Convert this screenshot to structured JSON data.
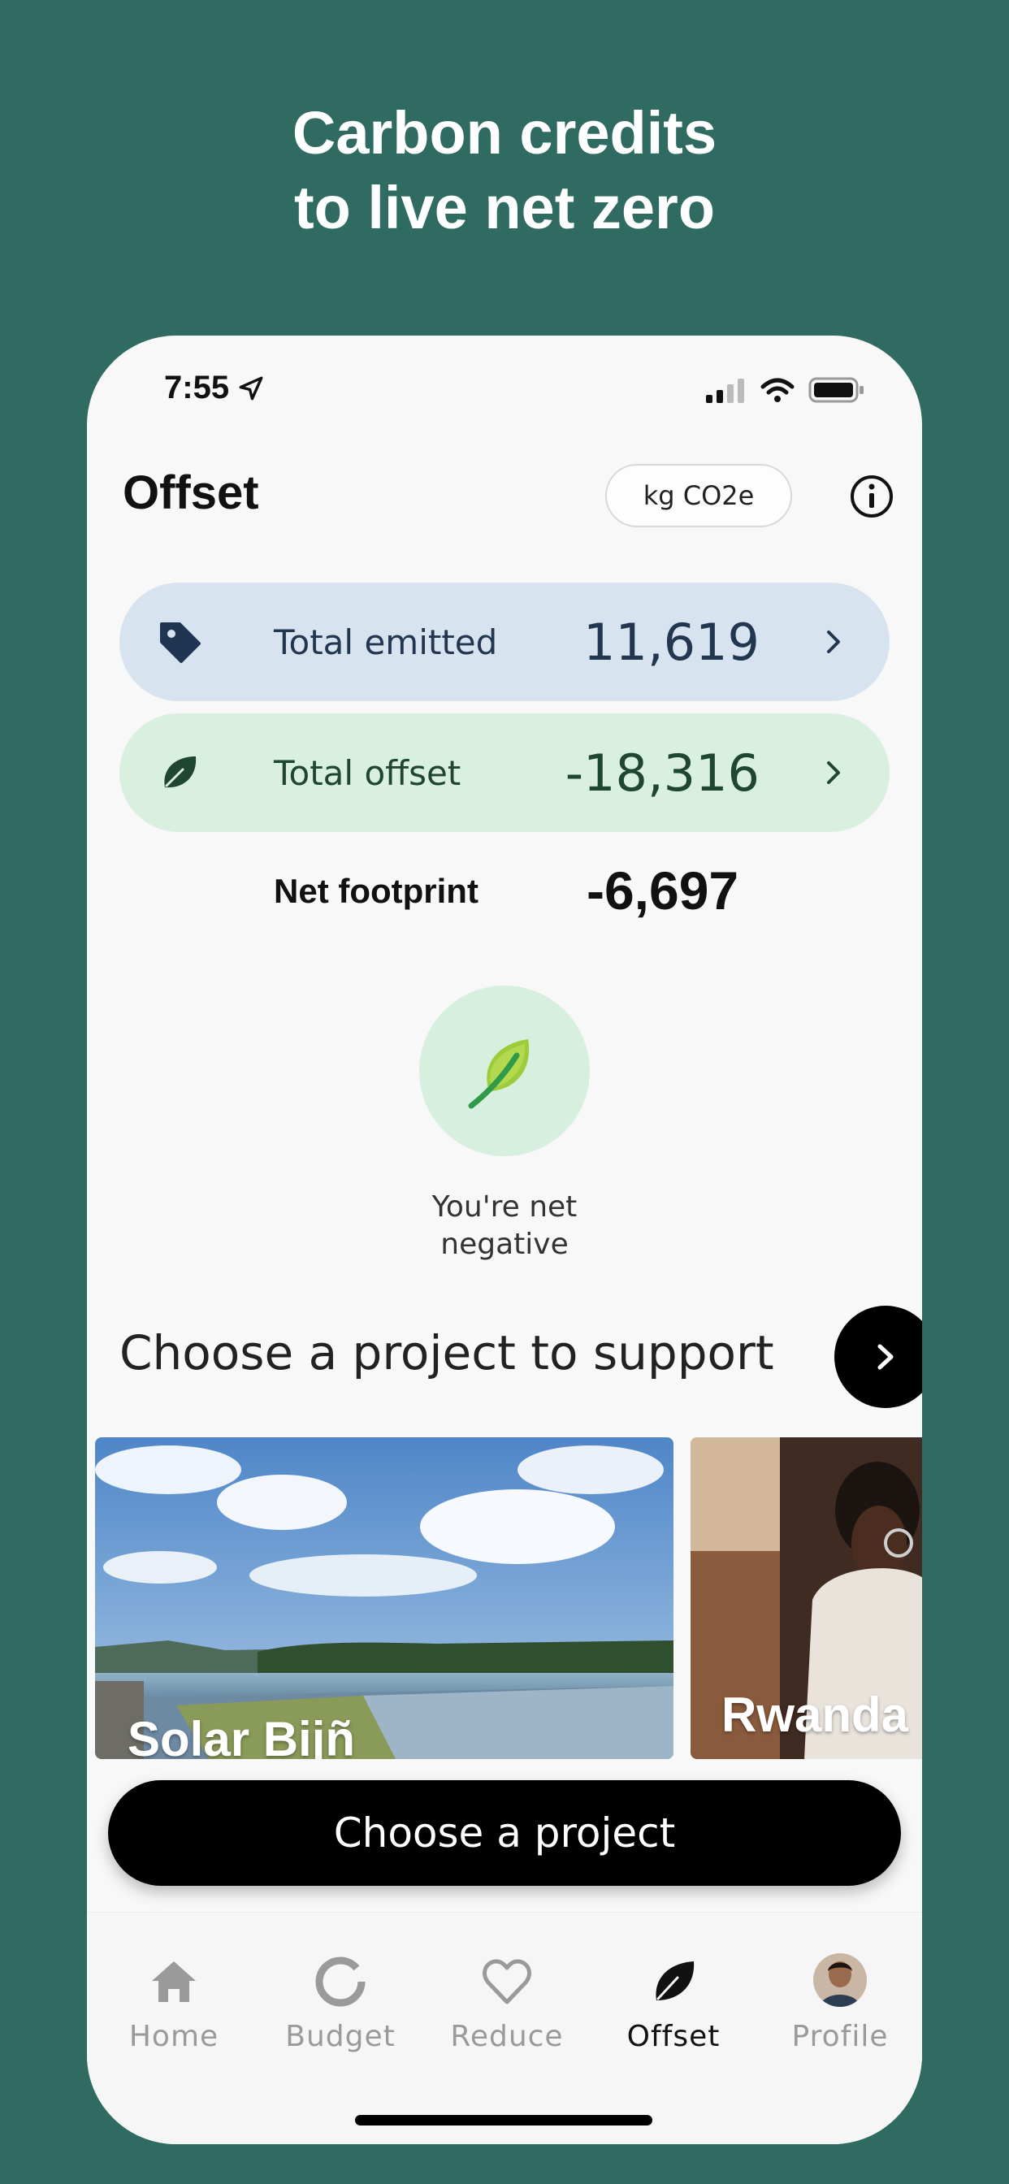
{
  "headline": {
    "line1": "Carbon credits",
    "line2": "to live net zero"
  },
  "status_bar": {
    "time": "7:55"
  },
  "header": {
    "title": "Offset",
    "unit_label": "kg CO2e"
  },
  "summary": {
    "emitted": {
      "label": "Total emitted",
      "value": "11,619"
    },
    "offset": {
      "label": "Total offset",
      "value": "-18,316"
    },
    "net": {
      "label": "Net footprint",
      "value": "-6,697"
    },
    "status": "You're net negative"
  },
  "projects": {
    "section_title": "Choose a project to support",
    "cards": [
      {
        "label": "Solar Bijñ"
      },
      {
        "label": "Rwanda"
      }
    ],
    "cta_label": "Choose a project"
  },
  "tabs": [
    {
      "label": "Home",
      "icon": "home-icon"
    },
    {
      "label": "Budget",
      "icon": "budget-icon"
    },
    {
      "label": "Reduce",
      "icon": "heart-icon"
    },
    {
      "label": "Offset",
      "icon": "leaf-icon",
      "active": true
    },
    {
      "label": "Profile",
      "icon": "avatar"
    }
  ],
  "colors": {
    "background": "#2f6b61",
    "emitted_bg": "#d7e3ef",
    "offset_bg": "#d9efe0",
    "accent_dark": "#000000"
  }
}
